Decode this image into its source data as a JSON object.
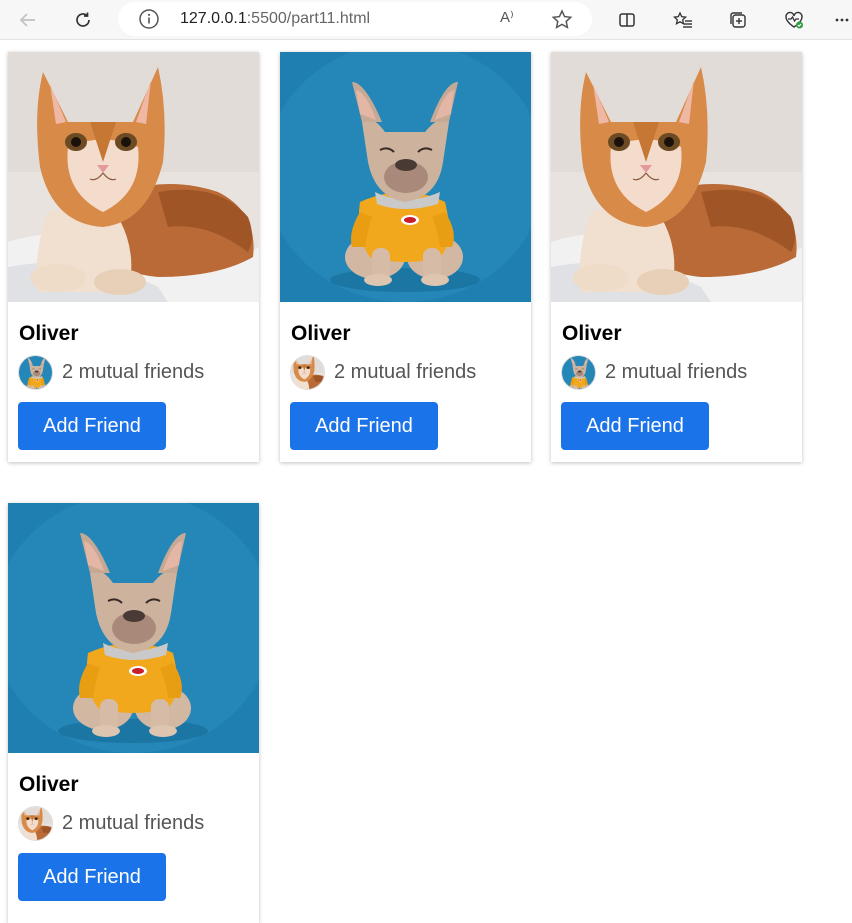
{
  "browser": {
    "url_host": "127.0.0.1",
    "url_rest": ":5500/part11.html",
    "read_aloud_label": "A⁾",
    "icons": [
      "back-icon",
      "refresh-icon",
      "info-icon",
      "read-aloud-icon",
      "favorite-star-icon",
      "split-screen-icon",
      "favorites-icon",
      "collections-icon",
      "browser-essentials-icon",
      "more-icon"
    ]
  },
  "cards": [
    {
      "name": "Oliver",
      "mutual": "2 mutual friends",
      "button": "Add Friend",
      "photo": "cat",
      "avatar": "dog"
    },
    {
      "name": "Oliver",
      "mutual": "2 mutual friends",
      "button": "Add Friend",
      "photo": "dog",
      "avatar": "cat"
    },
    {
      "name": "Oliver",
      "mutual": "2 mutual friends",
      "button": "Add Friend",
      "photo": "cat",
      "avatar": "dog"
    },
    {
      "name": "Oliver",
      "mutual": "2 mutual friends",
      "button": "Add Friend",
      "photo": "dog",
      "avatar": "cat"
    }
  ],
  "colors": {
    "button": "#1a73e8",
    "dog_bg": "#1e7fb0",
    "sweater": "#f2a81c",
    "cat_fur": "#d88a48"
  }
}
